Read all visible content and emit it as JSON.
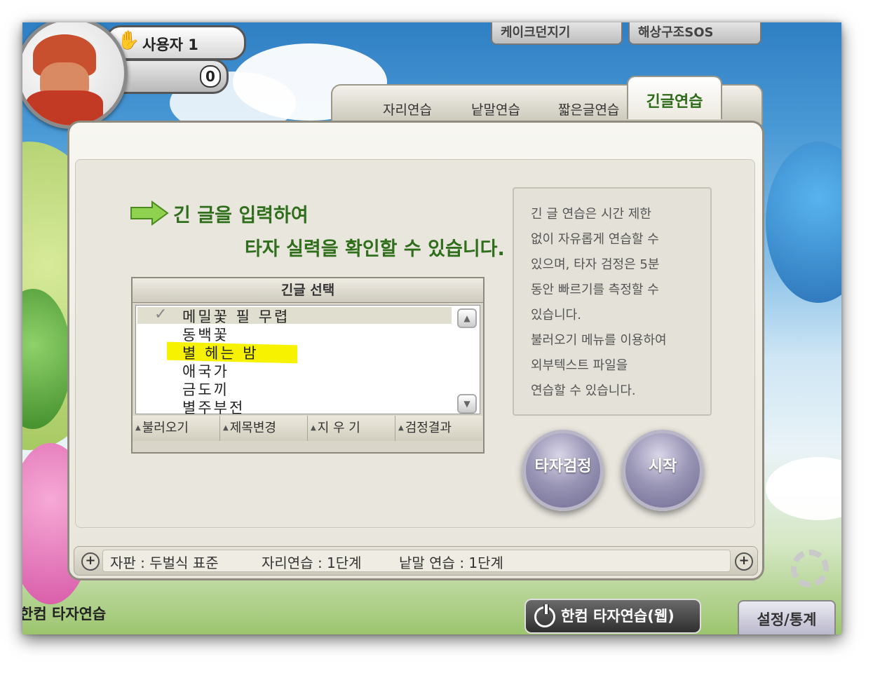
{
  "user": {
    "name": "사용자 1",
    "score": "0"
  },
  "top_buttons": {
    "cake": "케이크던지기",
    "sos": "해상구조SOS"
  },
  "tabs": [
    {
      "label": "자리연습"
    },
    {
      "label": "낱말연습"
    },
    {
      "label": "짧은글연습"
    },
    {
      "label": "긴글연습",
      "active": true
    }
  ],
  "intro": {
    "line1": "긴 글을 입력하여",
    "line2": "타자 실력을 확인할 수 있습니다."
  },
  "list": {
    "header": "긴글 선택",
    "items": [
      "메밀꽃 필 무렵",
      "동백꽃",
      "별 헤는 밤",
      "애국가",
      "금도끼",
      "별주부전"
    ],
    "selected": "메밀꽃 필 무렵",
    "highlighted": "별 헤는 밤",
    "highlight_color": "#f7f300"
  },
  "list_actions": {
    "load": "불러오기",
    "rename": "제목변경",
    "delete": "지 우 기",
    "results": "검정결과"
  },
  "info": {
    "lines": [
      "긴 글 연습은 시간 제한",
      "없이 자유롭게 연습할 수",
      "있으며, 타자 검정은 5분",
      "동안 빠르기를 측정할 수",
      "있습니다.",
      "불러오기 메뉴를 이용하여",
      "외부텍스트 파일을",
      "연습할 수 있습니다."
    ]
  },
  "actions": {
    "test": "타자검정",
    "start": "시작"
  },
  "status": {
    "keyboard": "자판 : 두벌식 표준",
    "position": "자리연습 : 1단계",
    "word": "낱말 연습 : 1단계"
  },
  "footer": {
    "web_button": "한컴 타자연습(웹)",
    "settings_button": "설정/통계",
    "logo": "한컴 타자연습"
  },
  "colors": {
    "accent_green": "#2f6e1a",
    "round_button": "#8f8bb0"
  },
  "icons": [
    "hand-icon",
    "arrow-right-icon",
    "check-icon",
    "scroll-up-icon",
    "scroll-down-icon",
    "plus-icon",
    "power-icon",
    "gear-icon"
  ]
}
